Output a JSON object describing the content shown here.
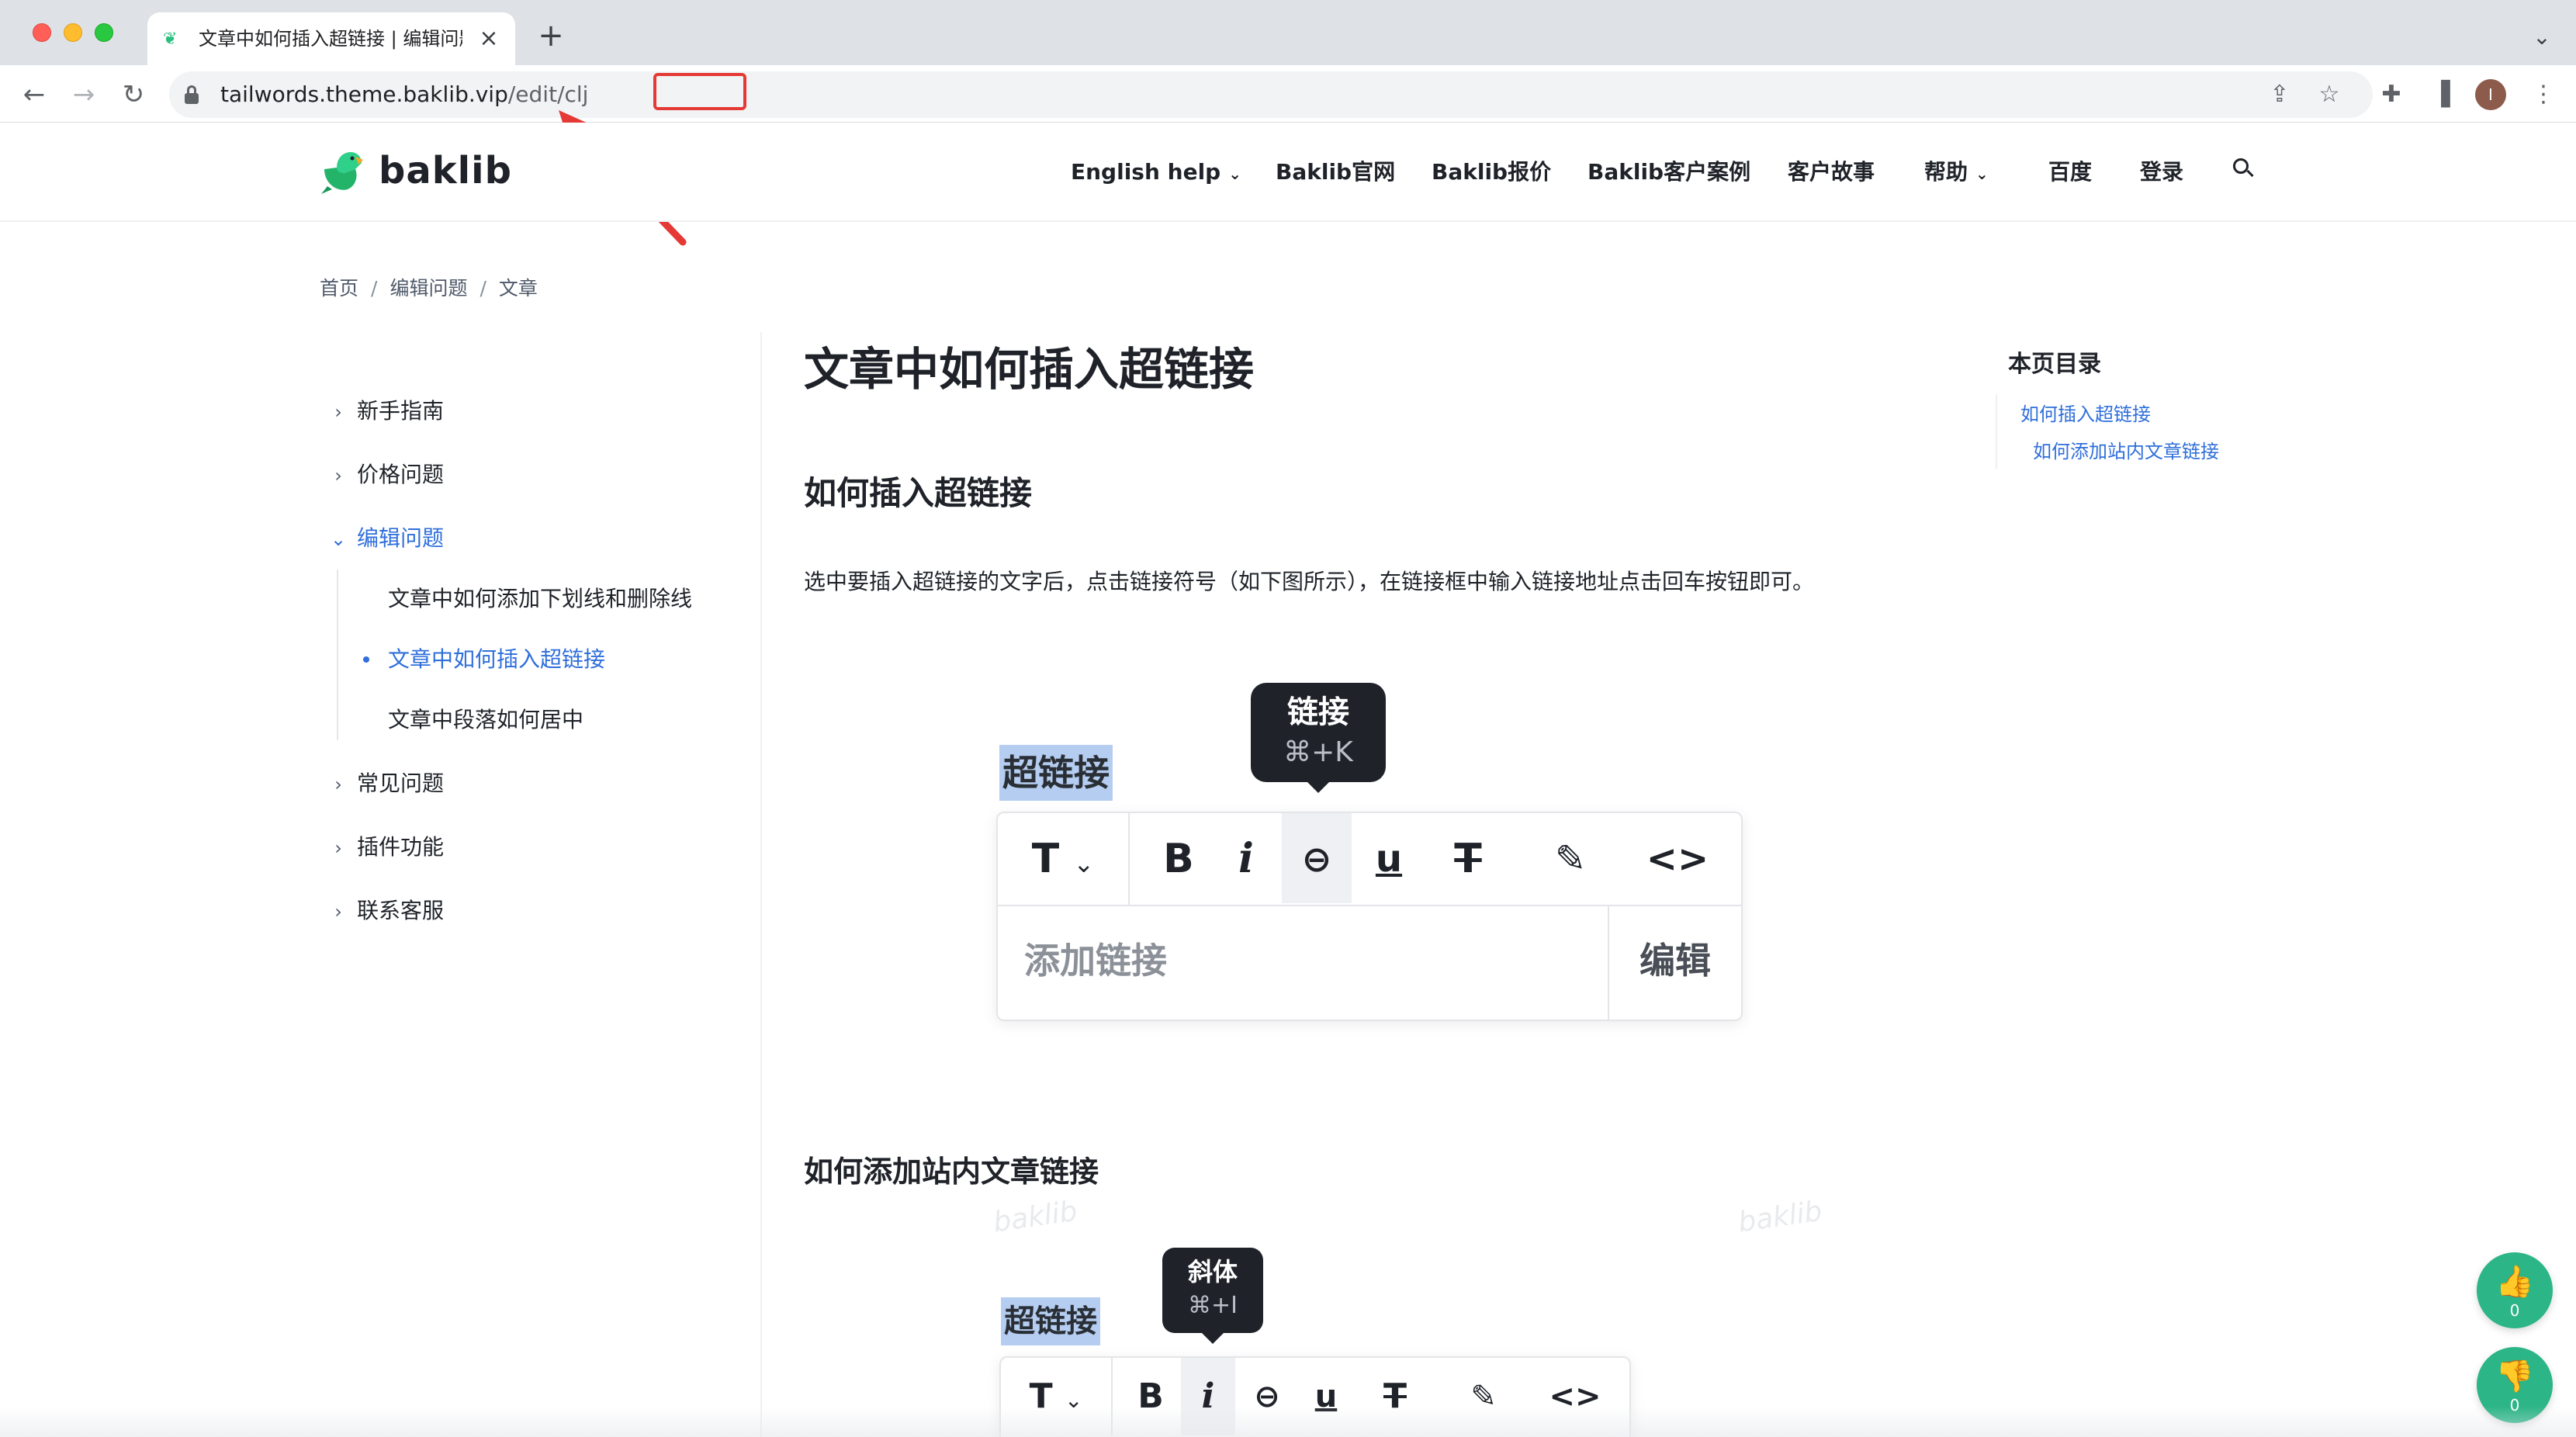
{
  "browser": {
    "tab_title": "文章中如何插入超链接 | 编辑问题",
    "tab_close": "×",
    "new_tab": "+",
    "tab_list": "⌄",
    "url_host": "tailwords.theme.baklib.vip",
    "url_path": "/edit/clj",
    "avatar_initial": "I",
    "icons": {
      "back": "back-arrow-icon",
      "forward": "forward-arrow-icon",
      "reload": "reload-icon",
      "share": "share-icon",
      "bookmark": "star-icon",
      "extensions": "puzzle-icon",
      "sidepanel": "sidepanel-icon",
      "menu": "kebab-menu-icon"
    }
  },
  "header": {
    "logo_text": "baklib",
    "nav": [
      {
        "label": "English help",
        "has_dropdown": true
      },
      {
        "label": "Baklib官网"
      },
      {
        "label": "Baklib报价"
      },
      {
        "label": "Baklib客户案例"
      },
      {
        "label": "客户故事"
      },
      {
        "label": "帮助",
        "has_dropdown": true
      },
      {
        "label": "百度"
      },
      {
        "label": "登录"
      }
    ]
  },
  "breadcrumb": [
    "首页",
    "编辑问题",
    "文章"
  ],
  "sidebar": {
    "items": [
      {
        "label": "新手指南",
        "expanded": false
      },
      {
        "label": "价格问题",
        "expanded": false
      },
      {
        "label": "编辑问题",
        "expanded": true
      },
      {
        "label": "常见问题",
        "expanded": false
      },
      {
        "label": "插件功能",
        "expanded": false
      },
      {
        "label": "联系客服",
        "expanded": false
      }
    ],
    "subitems": [
      {
        "label": "文章中如何添加下划线和删除线"
      },
      {
        "label": "文章中如何插入超链接",
        "current": true
      },
      {
        "label": "文章中段落如何居中"
      }
    ]
  },
  "article": {
    "title": "文章中如何插入超链接",
    "section1": "如何插入超链接",
    "paragraph": "选中要插入超链接的文字后，点击链接符号（如下图所示），在链接框中输入链接地址点击回车按钮即可。",
    "section2": "如何添加站内文章链接",
    "demo1": {
      "selected_text": "超链接",
      "tooltip_title": "链接",
      "tooltip_key": "⌘+K",
      "link_placeholder": "添加链接",
      "edit_label": "编辑"
    },
    "demo2": {
      "selected_text": "超链接",
      "tooltip_title": "斜体",
      "tooltip_key": "⌘+I"
    },
    "watermark": "baklib"
  },
  "toc": {
    "title": "本页目录",
    "links": [
      "如何插入超链接",
      "如何添加站内文章链接"
    ]
  },
  "votes": {
    "up_count": "0",
    "down_count": "0"
  },
  "colors": {
    "accent": "#2f6fdb",
    "vote_green": "#2cb586",
    "annotation_red": "#e53935",
    "selection": "#b4cdf0"
  }
}
